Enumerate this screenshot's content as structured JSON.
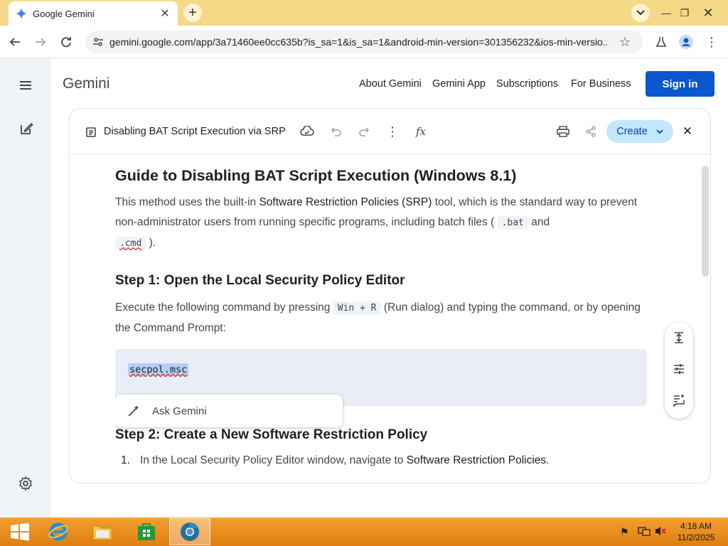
{
  "browser": {
    "tab_title": "Google Gemini",
    "url": "gemini.google.com/app/3a71460ee0cc635b?is_sa=1&is_sa=1&android-min-version=301356232&ios-min-versio..."
  },
  "header": {
    "brand": "Gemini",
    "nav": [
      "About Gemini",
      "Gemini App",
      "Subscriptions",
      "For Business"
    ],
    "sign_in": "Sign in"
  },
  "canvas": {
    "title": "Disabling BAT Script Execution via SRP",
    "create_label": "Create"
  },
  "doc": {
    "h1": "Guide to Disabling BAT Script Execution (Windows 8.1)",
    "intro_1": "This method uses the built-in ",
    "intro_bold": "Software Restriction Policies (SRP)",
    "intro_2": " tool, which is the standard way to prevent non-administrator users from running specific programs, including batch files ( ",
    "code_bat": ".bat",
    "intro_and": " and",
    "code_cmd": ".cmd",
    "intro_end": " ).",
    "step1_heading": "Step 1: Open the Local Security Policy Editor",
    "step1_text_1": "Execute the following command by pressing ",
    "step1_code": "Win + R",
    "step1_text_2": " (Run dialog) and typing the command, or by opening the Command Prompt:",
    "codeblock": "secpol.msc",
    "ask_gemini": "Ask Gemini",
    "step2_heading": "Step 2: Create a New Software Restriction Policy",
    "list_num": "1.",
    "list_text_1": "In the Local Security Policy Editor window, navigate to ",
    "list_bold": "Software Restriction Policies",
    "list_text_2": "."
  },
  "taskbar": {
    "time": "4:18 AM",
    "date": "11/2/2025"
  },
  "colors": {
    "tabstrip": "#f5d986",
    "accent": "#0b57d0",
    "create_bg": "#c2e7ff",
    "taskbar": "#e8901e"
  }
}
